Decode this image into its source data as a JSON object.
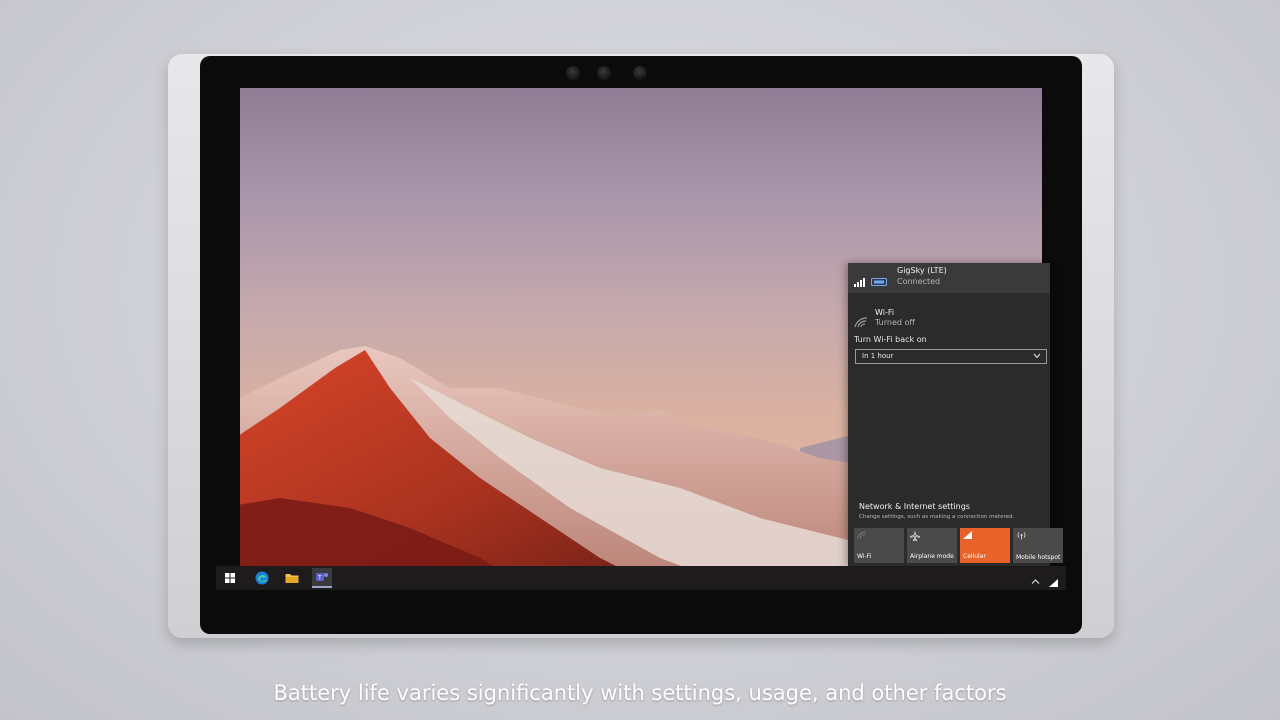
{
  "network_flyout": {
    "cellular": {
      "name": "GigSky (LTE)",
      "status": "Connected"
    },
    "wifi": {
      "name": "Wi-Fi",
      "status": "Turned off"
    },
    "wifi_back_label": "Turn Wi-Fi back on",
    "wifi_back_value": "In 1 hour",
    "settings_link": "Network & Internet settings",
    "settings_desc": "Change settings, such as making a connection metered.",
    "quick_actions": [
      {
        "label": "Wi-Fi",
        "state": "off",
        "icon": "wifi-icon"
      },
      {
        "label": "Airplane mode",
        "state": "off",
        "icon": "airplane-icon"
      },
      {
        "label": "Cellular",
        "state": "on",
        "icon": "cellular-icon"
      },
      {
        "label": "Mobile hotspot",
        "state": "off",
        "icon": "hotspot-icon"
      }
    ]
  },
  "taskbar": {
    "icons": [
      "windows-start-icon",
      "edge-browser-icon",
      "file-explorer-icon",
      "teams-icon"
    ]
  },
  "caption": "Battery life varies significantly with settings, usage, and other factors",
  "colors": {
    "accent": "#e8622a",
    "flyout_bg": "#2b2b2b",
    "taskbar_bg": "#1d1b1c"
  }
}
